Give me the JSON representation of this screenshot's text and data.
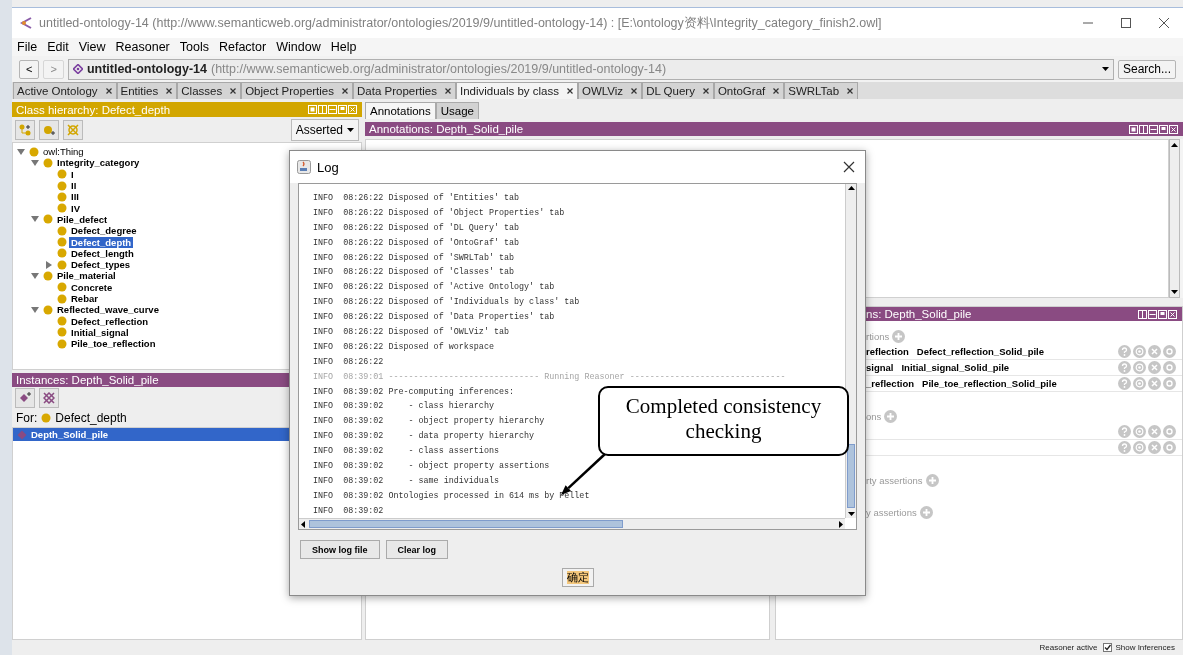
{
  "window": {
    "title": "untitled-ontology-14 (http://www.semanticweb.org/administrator/ontologies/2019/9/untitled-ontology-14)  : [E:\\ontology资料\\Integrity_category_finish2.owl]"
  },
  "menu": [
    "File",
    "Edit",
    "View",
    "Reasoner",
    "Tools",
    "Refactor",
    "Window",
    "Help"
  ],
  "address_bar": {
    "back": "<",
    "forward": ">",
    "forward_disabled": true,
    "ontology_name": "untitled-ontology-14",
    "ontology_iri": "(http://www.semanticweb.org/administrator/ontologies/2019/9/untitled-ontology-14)",
    "search_button": "Search..."
  },
  "tabs": [
    {
      "label": "Active Ontology",
      "selected": false
    },
    {
      "label": "Entities",
      "selected": false
    },
    {
      "label": "Classes",
      "selected": false
    },
    {
      "label": "Object Properties",
      "selected": false
    },
    {
      "label": "Data Properties",
      "selected": false
    },
    {
      "label": "Individuals by class",
      "selected": true
    },
    {
      "label": "OWLViz",
      "selected": false
    },
    {
      "label": "DL Query",
      "selected": false
    },
    {
      "label": "OntoGraf",
      "selected": false
    },
    {
      "label": "SWRLTab",
      "selected": false
    }
  ],
  "class_hierarchy": {
    "title": "Class hierarchy: Defect_depth",
    "mode": "Asserted",
    "tree": [
      {
        "label": "owl:Thing",
        "bold": false,
        "selected": false,
        "expanded": true,
        "children": [
          {
            "label": "Integrity_category",
            "bold": true,
            "selected": false,
            "expanded": true,
            "children": [
              {
                "label": "I",
                "bold": true,
                "selected": false
              },
              {
                "label": "II",
                "bold": true,
                "selected": false
              },
              {
                "label": "III",
                "bold": true,
                "selected": false
              },
              {
                "label": "IV",
                "bold": true,
                "selected": false
              }
            ]
          },
          {
            "label": "Pile_defect",
            "bold": true,
            "selected": false,
            "expanded": true,
            "children": [
              {
                "label": "Defect_degree",
                "bold": true,
                "selected": false
              },
              {
                "label": "Defect_depth",
                "bold": true,
                "selected": true
              },
              {
                "label": "Defect_length",
                "bold": true,
                "selected": false
              },
              {
                "label": "Defect_types",
                "bold": true,
                "selected": false,
                "expanded": false
              }
            ]
          },
          {
            "label": "Pile_material",
            "bold": true,
            "selected": false,
            "expanded": true,
            "children": [
              {
                "label": "Concrete",
                "bold": true,
                "selected": false
              },
              {
                "label": "Rebar",
                "bold": true,
                "selected": false
              }
            ]
          },
          {
            "label": "Reflected_wave_curve",
            "bold": true,
            "selected": false,
            "expanded": true,
            "children": [
              {
                "label": "Defect_reflection",
                "bold": true,
                "selected": false
              },
              {
                "label": "Initial_signal",
                "bold": true,
                "selected": false
              },
              {
                "label": "Pile_toe_reflection",
                "bold": true,
                "selected": false
              }
            ]
          }
        ]
      }
    ]
  },
  "instances": {
    "title": "Instances: Depth_Solid_pile",
    "for_label": "For:",
    "for_class": "Defect_depth",
    "items": [
      {
        "label": "Depth_Solid_pile",
        "selected": true
      }
    ]
  },
  "editor_tabs": [
    {
      "label": "Annotations",
      "selected": true
    },
    {
      "label": "Usage",
      "selected": false
    }
  ],
  "annotations_panel": {
    "title": "Annotations: Depth_Solid_pile"
  },
  "description_panel": {
    "title": "ns: Depth_Solid_pile",
    "sections": [
      {
        "header": "rtions",
        "rows": [
          {
            "kind": "assertion",
            "property": "reflection",
            "value": "Defect_reflection_Solid_pile"
          },
          {
            "kind": "assertion",
            "property": "signal",
            "value": "Initial_signal_Solid_pile"
          },
          {
            "kind": "assertion",
            "property": "_reflection",
            "value": "Pile_toe_reflection_Solid_pile"
          }
        ]
      },
      {
        "header": "ons",
        "rows": [
          {
            "kind": "blank"
          },
          {
            "kind": "blank"
          }
        ]
      },
      {
        "header": "rty assertions"
      },
      {
        "header": "y assertions"
      }
    ]
  },
  "status_bar": {
    "reasoner": "Reasoner active",
    "show_inferences": {
      "label": "Show Inferences",
      "checked": true
    }
  },
  "log_dialog": {
    "title": "Log",
    "lines": [
      {
        "text": "INFO  08:26:22 Disposed of 'Entities' tab",
        "dimmed": false
      },
      {
        "text": "INFO  08:26:22 Disposed of 'Object Properties' tab",
        "dimmed": false
      },
      {
        "text": "INFO  08:26:22 Disposed of 'DL Query' tab",
        "dimmed": false
      },
      {
        "text": "INFO  08:26:22 Disposed of 'OntoGraf' tab",
        "dimmed": false
      },
      {
        "text": "INFO  08:26:22 Disposed of 'SWRLTab' tab",
        "dimmed": false
      },
      {
        "text": "INFO  08:26:22 Disposed of 'Classes' tab",
        "dimmed": false
      },
      {
        "text": "INFO  08:26:22 Disposed of 'Active Ontology' tab",
        "dimmed": false
      },
      {
        "text": "INFO  08:26:22 Disposed of 'Individuals by class' tab",
        "dimmed": false
      },
      {
        "text": "INFO  08:26:22 Disposed of 'Data Properties' tab",
        "dimmed": false
      },
      {
        "text": "INFO  08:26:22 Disposed of 'OWLViz' tab",
        "dimmed": false
      },
      {
        "text": "INFO  08:26:22 Disposed of workspace",
        "dimmed": false
      },
      {
        "text": "INFO  08:26:22",
        "dimmed": false
      },
      {
        "text": "INFO  08:39:01 ------------------------------ Running Reasoner -------------------------------",
        "dimmed": true
      },
      {
        "text": "INFO  08:39:02 Pre-computing inferences:",
        "dimmed": false
      },
      {
        "text": "INFO  08:39:02     - class hierarchy",
        "dimmed": false
      },
      {
        "text": "INFO  08:39:02     - object property hierarchy",
        "dimmed": false
      },
      {
        "text": "INFO  08:39:02     - data property hierarchy",
        "dimmed": false
      },
      {
        "text": "INFO  08:39:02     - class assertions",
        "dimmed": false
      },
      {
        "text": "INFO  08:39:02     - object property assertions",
        "dimmed": false
      },
      {
        "text": "INFO  08:39:02     - same individuals",
        "dimmed": false
      },
      {
        "text": "INFO  08:39:02 Ontologies processed in 614 ms by Pellet",
        "dimmed": false
      },
      {
        "text": "INFO  08:39:02",
        "dimmed": false
      }
    ],
    "buttons": [
      "Show log file",
      "Clear log"
    ],
    "ok_button": "确定"
  },
  "callout": {
    "text": "Completed consistency checking"
  }
}
